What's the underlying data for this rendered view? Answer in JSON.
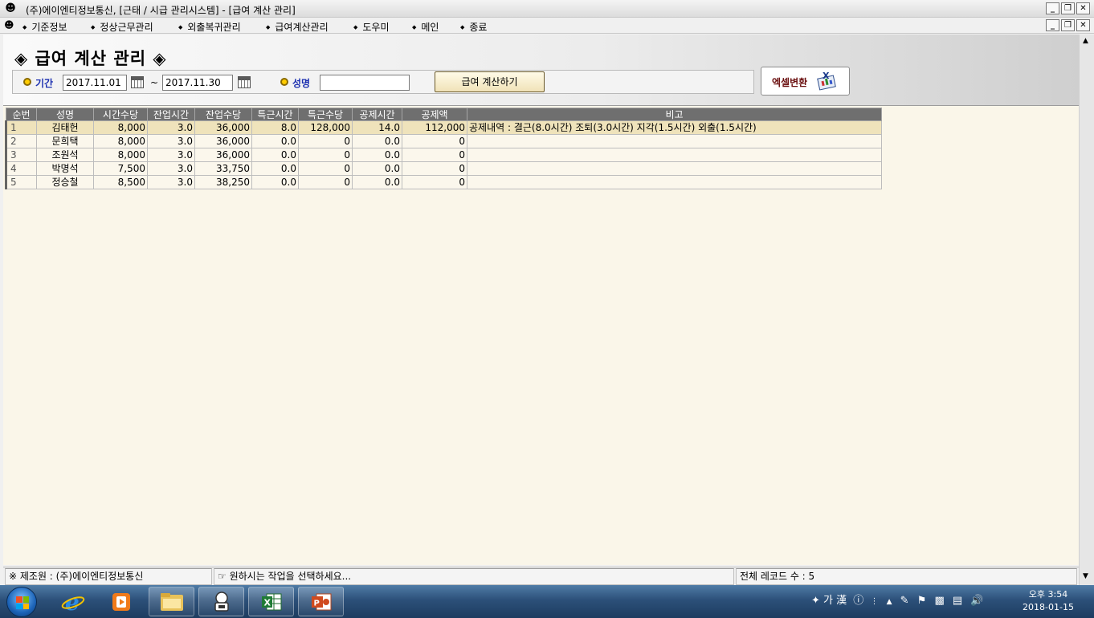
{
  "window": {
    "title": "(주)에이엔티정보통신, [근태 / 시급 관리시스템]  - [급여 계산 관리]"
  },
  "menu": {
    "items": [
      "기준정보",
      "정상근무관리",
      "외출복귀관리",
      "급여계산관리",
      "도우미",
      "메인",
      "종료"
    ]
  },
  "page": {
    "title": "급여 계산 관리",
    "title_mark": "◈"
  },
  "filter": {
    "period_label": "기간",
    "date_from": "2017.11.01",
    "tilde": "~",
    "date_to": "2017.11.30",
    "name_label": "성명",
    "name_value": "",
    "calc_button": "급여 계산하기",
    "excel_button": "엑셀변환"
  },
  "grid": {
    "columns": [
      "순번",
      "성명",
      "시간수당",
      "잔업시간",
      "잔업수당",
      "특근시간",
      "특근수당",
      "공제시간",
      "공제액",
      "비고"
    ],
    "rows": [
      [
        "1",
        "김태헌",
        "8,000",
        "3.0",
        "36,000",
        "8.0",
        "128,000",
        "14.0",
        "112,000",
        "공제내역 : 결근(8.0시간)  조퇴(3.0시간)  지각(1.5시간)  외출(1.5시간)"
      ],
      [
        "2",
        "문희택",
        "8,000",
        "3.0",
        "36,000",
        "0.0",
        "0",
        "0.0",
        "0",
        ""
      ],
      [
        "3",
        "조원석",
        "8,000",
        "3.0",
        "36,000",
        "0.0",
        "0",
        "0.0",
        "0",
        ""
      ],
      [
        "4",
        "박명석",
        "7,500",
        "3.0",
        "33,750",
        "0.0",
        "0",
        "0.0",
        "0",
        ""
      ],
      [
        "5",
        "정승철",
        "8,500",
        "3.0",
        "38,250",
        "0.0",
        "0",
        "0.0",
        "0",
        ""
      ]
    ],
    "selected_row": 0
  },
  "status": {
    "maker": "※ 제조원 : (주)에이엔티정보통신",
    "hint": "☞ 원하시는 작업을 선택하세요...",
    "records": "전체 레코드 수 : 5"
  },
  "taskbar": {
    "ime": "가 漢",
    "time": "오후 3:54",
    "date": "2018-01-15"
  },
  "icons": {
    "app": "app-person-icon",
    "calendar": "calendar-icon",
    "excel": "excel-export-icon",
    "start": "windows-start-icon",
    "ie": "internet-explorer-icon",
    "media": "media-player-icon",
    "explorer": "folder-explorer-icon",
    "app_task": "app-task-icon",
    "excel_task": "excel-app-icon",
    "ppt_task": "powerpoint-app-icon"
  }
}
